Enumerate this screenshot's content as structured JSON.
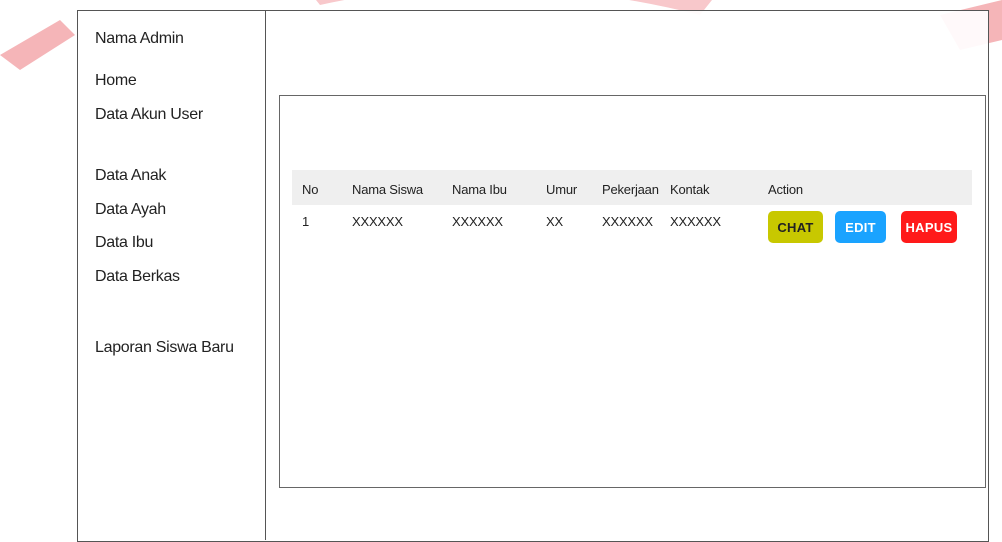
{
  "sidebar": {
    "title": "Nama Admin",
    "items": [
      {
        "label": "Home"
      },
      {
        "label": "Data Akun User"
      },
      {
        "label": "Data Anak"
      },
      {
        "label": "Data Ayah"
      },
      {
        "label": "Data Ibu"
      },
      {
        "label": "Data Berkas"
      },
      {
        "label": "Laporan Siswa Baru"
      }
    ]
  },
  "table": {
    "headers": [
      "No",
      "Nama Siswa",
      "Nama Ibu",
      "Umur",
      "Pekerjaan",
      "Kontak",
      "Action"
    ],
    "rows": [
      {
        "no": "1",
        "nama_siswa": "XXXXXX",
        "nama_ibu": "XXXXXX",
        "umur": "XX",
        "pekerjaan": "XXXXXX",
        "kontak": "XXXXXX"
      }
    ],
    "actions": {
      "chat": "CHAT",
      "edit": "EDIT",
      "hapus": "HAPUS"
    }
  },
  "colors": {
    "chat": "#c8c800",
    "edit": "#1aa3ff",
    "hapus": "#ff1a1a",
    "header_bg": "#efefef"
  }
}
